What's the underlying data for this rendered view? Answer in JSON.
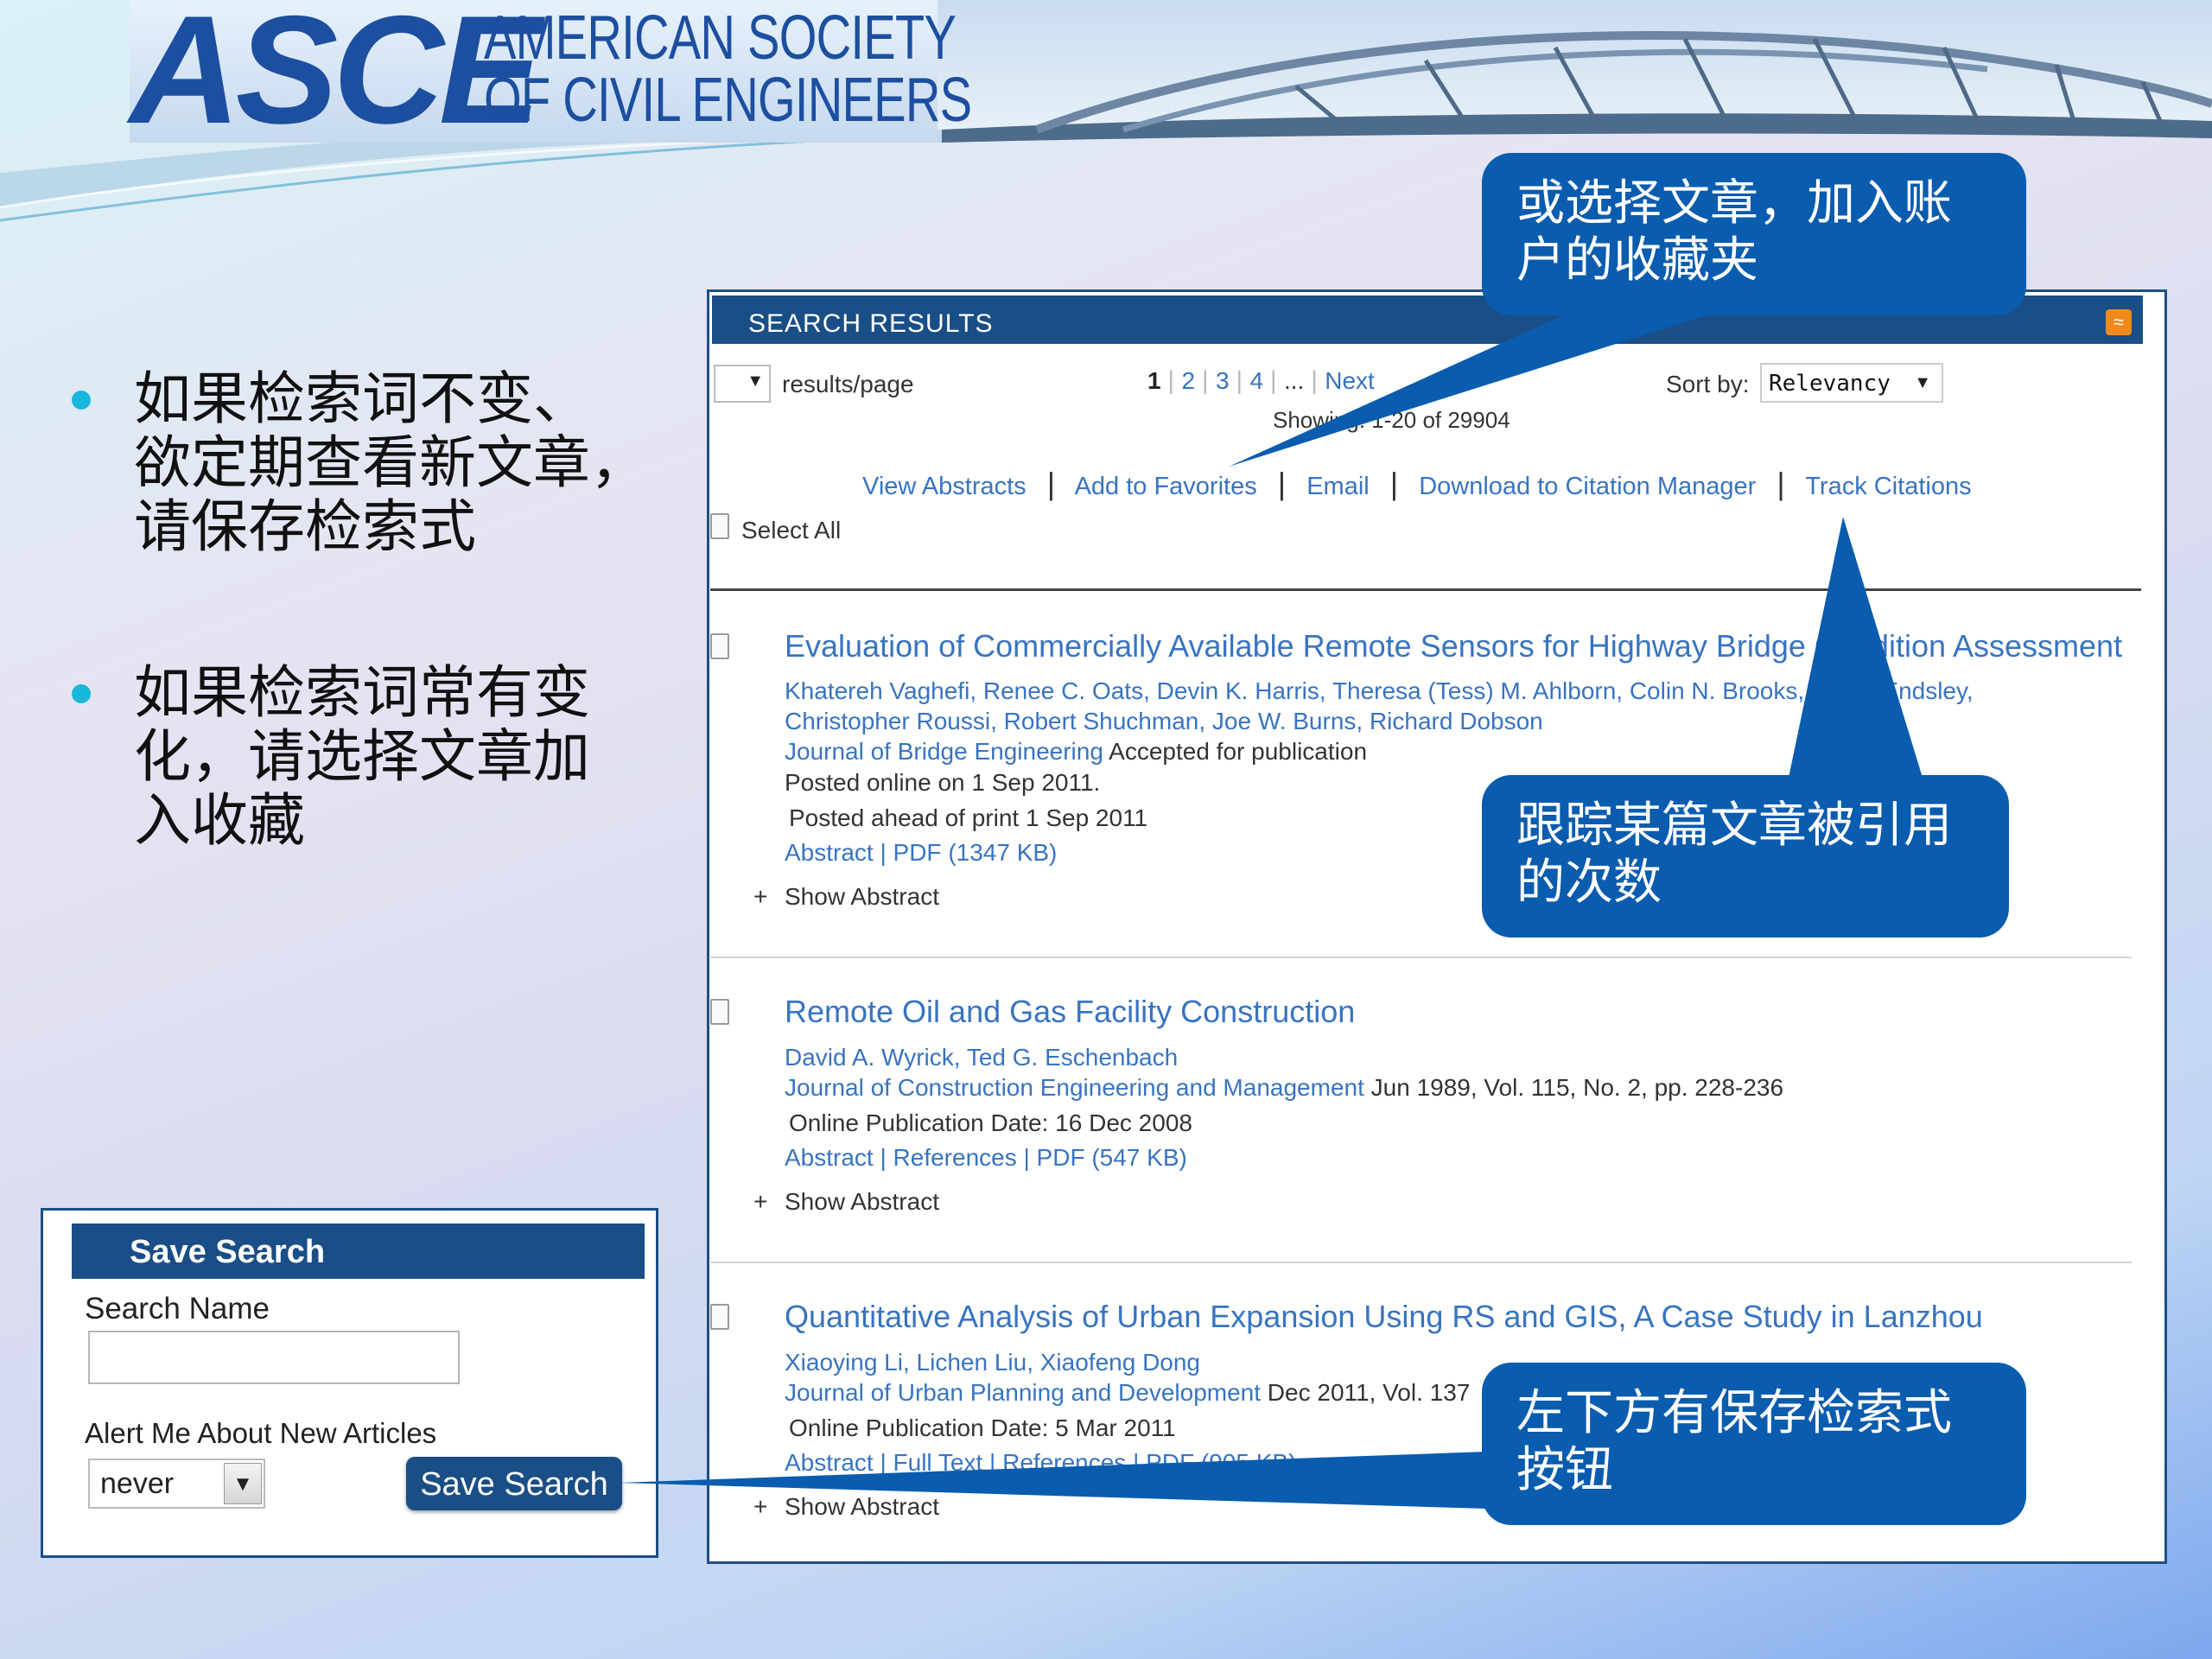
{
  "header": {
    "logo_mark": "ASCE",
    "logo_line1": "AMERICAN SOCIETY",
    "logo_line2": "OF CIVIL ENGINEERS"
  },
  "bullets": [
    {
      "lines": [
        "如果检索词不变、",
        "欲定期查看新文章，",
        "请保存检索式"
      ]
    },
    {
      "lines": [
        "如果检索词常有变",
        "化，请选择文章加",
        "入收藏"
      ]
    }
  ],
  "save_search": {
    "title": "Save Search",
    "name_label": "Search Name",
    "name_value": "",
    "alert_label": "Alert Me About New Articles",
    "alert_value": "never",
    "button": "Save Search"
  },
  "results": {
    "title": "SEARCH RESULTS",
    "per_page_value": "",
    "per_page_label": "results/page",
    "pages": [
      "1",
      "2",
      "3",
      "4",
      "...",
      "Next"
    ],
    "sort_label": "Sort by:",
    "sort_value": "Relevancy",
    "showing": "Showing: 1-20 of 29904",
    "actions": [
      "View Abstracts",
      "Add to Favorites",
      "Email",
      "Download to Citation Manager",
      "Track Citations"
    ],
    "select_all": "Select All",
    "items": [
      {
        "title": "Evaluation of Commercially Available Remote Sensors for Highway Bridge Condition Assessment",
        "authors1": "Khatereh Vaghefi, Renee C. Oats, Devin K. Harris, Theresa (Tess) M. Ahlborn, Colin N. Brooks, Arthur Endsley,",
        "authors2": "Christopher Roussi, Robert Shuchman, Joe W. Burns, Richard Dobson",
        "journal": "Journal of Bridge Engineering",
        "journal_rest": " Accepted for publication",
        "line4": "Posted online on 1 Sep 2011.",
        "line5": "Posted ahead of print 1 Sep 2011",
        "links": "Abstract | PDF (1347 KB)",
        "show": "Show Abstract"
      },
      {
        "title": "Remote Oil and Gas Facility Construction",
        "authors1": "David A. Wyrick, Ted G. Eschenbach",
        "journal": "Journal of Construction Engineering and Management",
        "journal_rest": " Jun 1989, Vol. 115, No. 2, pp. 228-236",
        "line4": "Online Publication Date: 16 Dec 2008",
        "links": "Abstract | References | PDF (547 KB)",
        "show": "Show Abstract"
      },
      {
        "title": "Quantitative Analysis of Urban Expansion Using RS and GIS, A Case Study in Lanzhou",
        "authors1": "Xiaoying Li, Lichen Liu, Xiaofeng Dong",
        "journal": "Journal of Urban Planning and Development",
        "journal_rest": " Dec 2011, Vol. 137",
        "line4": "Online Publication Date: 5 Mar 2011",
        "links": "Abstract | Full Text | References | PDF (905 KB)",
        "show": "Show Abstract"
      }
    ]
  },
  "callouts": {
    "favorites": [
      "或选择文章，加入账",
      "户的收藏夹"
    ],
    "track": [
      "跟踪某篇文章被引用",
      "的次数"
    ],
    "save": [
      "左下方有保存检索式",
      "按钮"
    ]
  },
  "colors": {
    "header_blue": "#1a4e86",
    "link_blue": "#3874c0",
    "callout_blue": "#0a5cae",
    "bullet_cyan": "#1ab7dc"
  }
}
